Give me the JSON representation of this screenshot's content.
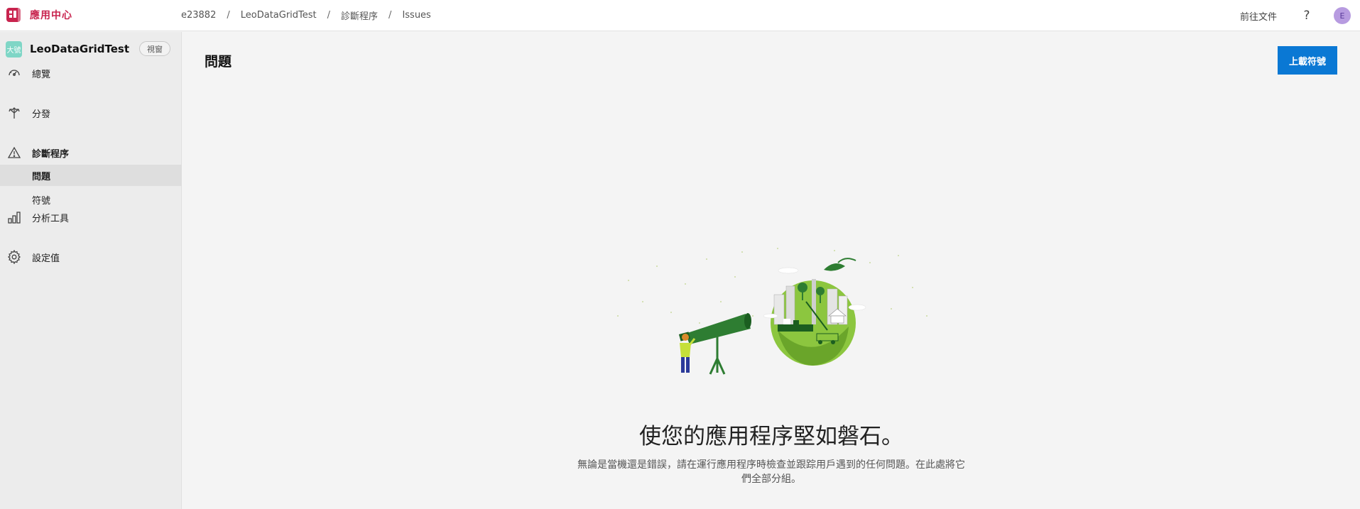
{
  "app": {
    "title": "應用中心",
    "brand_color": "#c8244e"
  },
  "breadcrumb": [
    "e23882",
    "LeoDataGridTest",
    "診斷程序",
    "Issues"
  ],
  "header": {
    "docs_label": "前往文件",
    "help_label": "?",
    "avatar_initial": "E"
  },
  "sidebar": {
    "app_icon_text": "大號",
    "app_name": "LeoDataGridTest",
    "platform_badge": "視窗",
    "items": [
      {
        "label": "總覽",
        "icon": "overview-icon"
      },
      {
        "label": "分發",
        "icon": "distribute-icon"
      },
      {
        "label": "診斷程序",
        "icon": "warning-icon",
        "subitems": [
          "問題",
          "符號"
        ],
        "active_subitem": "問題"
      },
      {
        "label": "分析工具",
        "icon": "chart-icon"
      },
      {
        "label": "設定值",
        "icon": "gear-icon"
      }
    ]
  },
  "main": {
    "title": "問題",
    "upload_button": "上載符號",
    "empty_title": "使您的應用程序堅如磐石。",
    "empty_description": "無論是當機還是錯誤，請在運行應用程序時檢查並跟踪用戶遇到的任何問題。在此處將它們全部分組。",
    "accent_color": "#0a78d4"
  }
}
